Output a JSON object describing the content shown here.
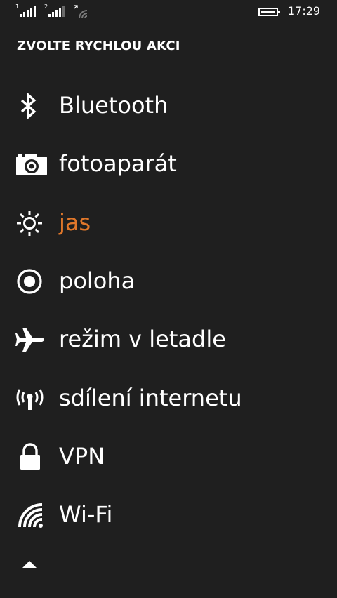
{
  "status_bar": {
    "sim1_label": "1",
    "sim2_label": "2",
    "time": "17:29",
    "icons": [
      "signal-sim1-icon",
      "signal-sim2-icon",
      "data-signal-icon",
      "battery-icon"
    ]
  },
  "page": {
    "title": "ZVOLTE RYCHLOU AKCI"
  },
  "actions": [
    {
      "label": "Bluetooth",
      "icon": "bluetooth-icon"
    },
    {
      "label": "fotoaparát",
      "icon": "camera-icon"
    },
    {
      "label": "jas",
      "icon": "brightness-icon",
      "active": true
    },
    {
      "label": "poloha",
      "icon": "location-icon"
    },
    {
      "label": "režim v letadle",
      "icon": "airplane-icon"
    },
    {
      "label": "sdílení internetu",
      "icon": "internet-sharing-icon"
    },
    {
      "label": "VPN",
      "icon": "lock-icon"
    },
    {
      "label": "Wi-Fi",
      "icon": "wifi-icon"
    }
  ],
  "colors": {
    "background": "#1f1f1f",
    "text": "#ffffff",
    "accent": "#e0772a"
  }
}
